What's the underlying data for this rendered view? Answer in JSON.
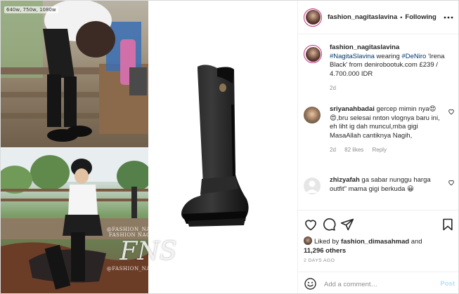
{
  "media": {
    "resolution_badge": "640w, 750w, 1080w",
    "watermark": {
      "top_line": "@FASHION_NAGITASLAVINA",
      "line2": "FASHION NAGITA SLAVINA",
      "logo": "FNS",
      "bottom_line": "@FASHION_NAGITASLAVINA"
    }
  },
  "header": {
    "username": "fashion_nagitaslavina",
    "separator": "•",
    "follow_label": "Following",
    "more_icon": "more-dots-icon"
  },
  "caption": {
    "username": "fashion_nagitaslavina",
    "hashtag1": "#NagitaSlavina",
    "text1": " wearing ",
    "hashtag2": "#DeNiro",
    "text2": " 'Irena Black' from denirobootuk.com £239 / 4.700.000 IDR",
    "time": "2d"
  },
  "comments": [
    {
      "username": "sriyanahbadai",
      "text": " gercep mimin nya😍😍,bru selesai nnton vlognya baru ini, eh liht ig dah muncul,mba gigi MasaAllah cantiknya Nagih,",
      "time": "2d",
      "likes": "82 likes",
      "reply_label": "Reply"
    },
    {
      "username": "zhizyafah",
      "text": " ga sabar nunggu harga outfit\" mama gigi berkuda 😀"
    }
  ],
  "actions": {
    "like_icon": "heart-icon",
    "comment_icon": "comment-icon",
    "share_icon": "share-icon",
    "save_icon": "bookmark-icon"
  },
  "likes": {
    "prefix": "Liked by ",
    "username": "fashion_dimasahmad",
    "middle": " and",
    "count": "11,296 others"
  },
  "date": "2 DAYS AGO",
  "add_comment": {
    "placeholder": "Add a comment…",
    "post_label": "Post"
  },
  "colors": {
    "link": "#00376b",
    "post_disabled": "#b2dffc",
    "secondary_text": "#8e8e8e",
    "border": "#efefef"
  }
}
